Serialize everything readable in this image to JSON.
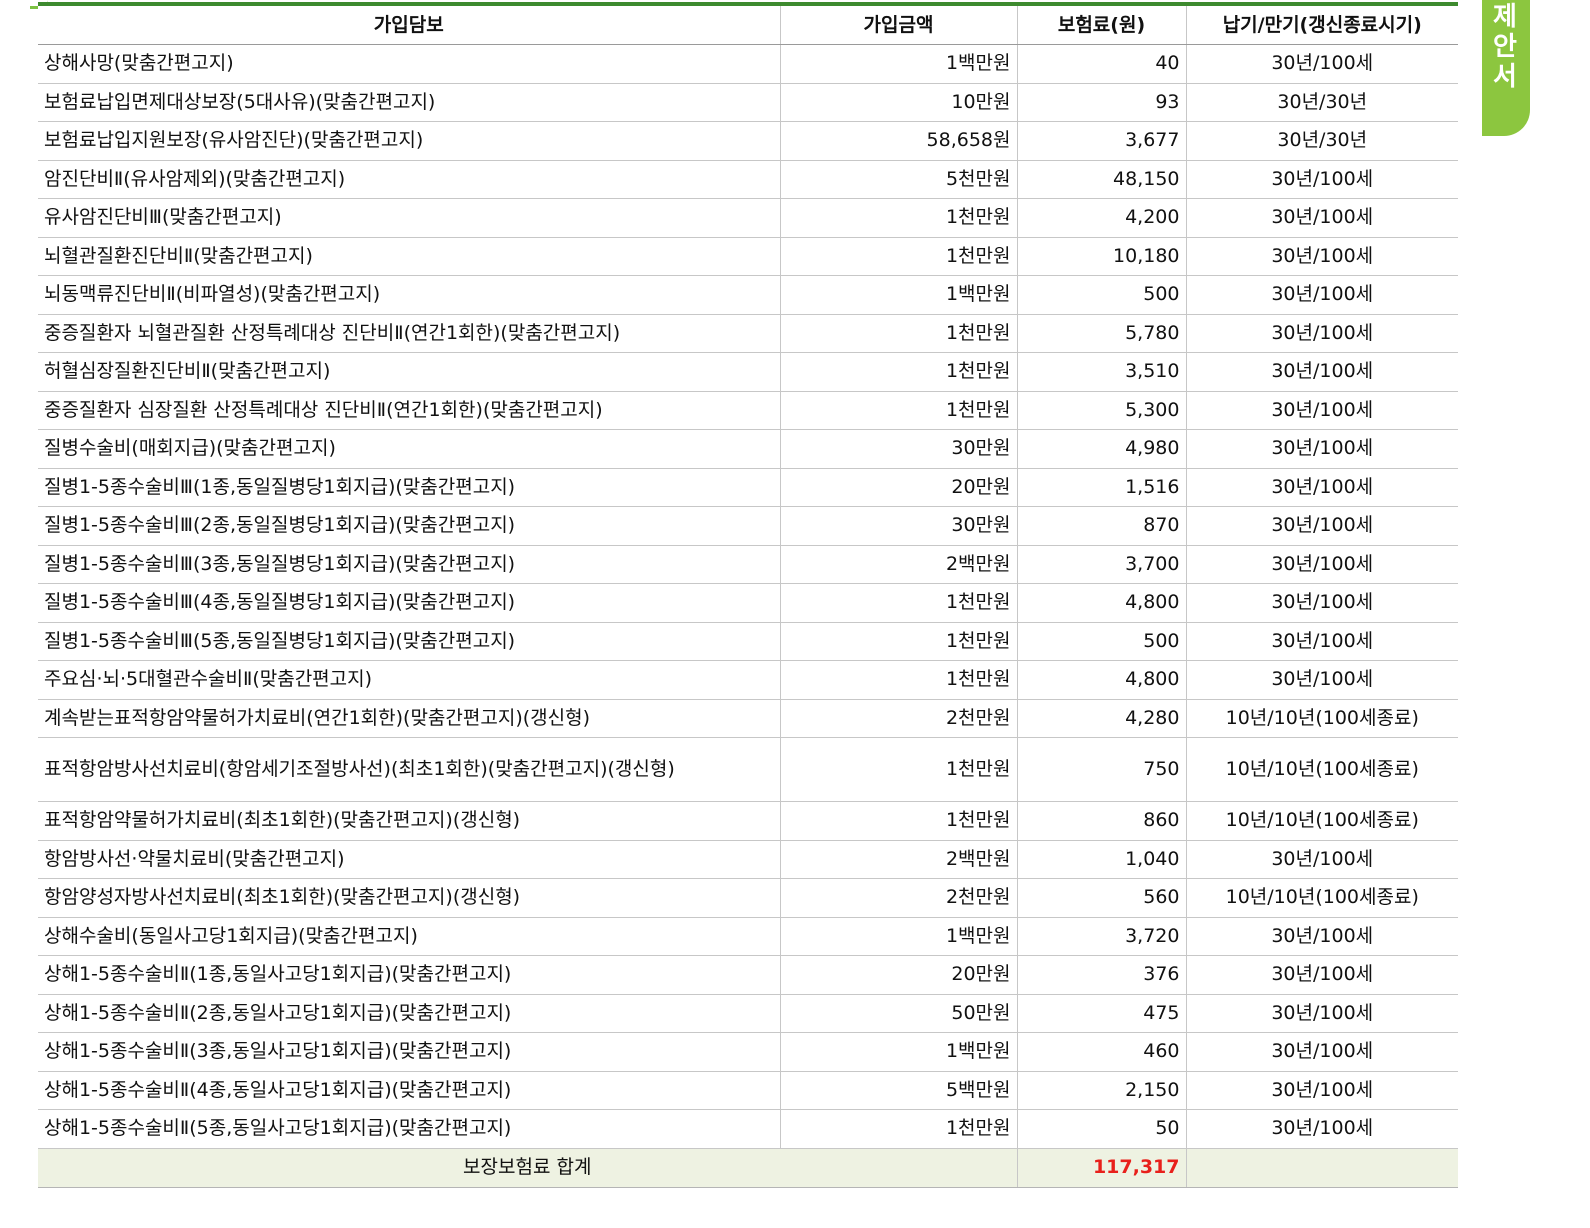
{
  "side_tab": {
    "chars": [
      "제",
      "안",
      "서"
    ]
  },
  "table": {
    "headers": [
      "가입담보",
      "가입금액",
      "보험료(원)",
      "납기/만기(갱신종료시기)"
    ],
    "rows": [
      {
        "name": "상해사망(맞춤간편고지)",
        "amount": "1백만원",
        "premium": "40",
        "period": "30년/100세"
      },
      {
        "name": "보험료납입면제대상보장(5대사유)(맞춤간편고지)",
        "amount": "10만원",
        "premium": "93",
        "period": "30년/30년"
      },
      {
        "name": "보험료납입지원보장(유사암진단)(맞춤간편고지)",
        "amount": "58,658원",
        "premium": "3,677",
        "period": "30년/30년"
      },
      {
        "name": "암진단비Ⅱ(유사암제외)(맞춤간편고지)",
        "amount": "5천만원",
        "premium": "48,150",
        "period": "30년/100세"
      },
      {
        "name": "유사암진단비Ⅲ(맞춤간편고지)",
        "amount": "1천만원",
        "premium": "4,200",
        "period": "30년/100세"
      },
      {
        "name": "뇌혈관질환진단비Ⅱ(맞춤간편고지)",
        "amount": "1천만원",
        "premium": "10,180",
        "period": "30년/100세"
      },
      {
        "name": "뇌동맥류진단비Ⅱ(비파열성)(맞춤간편고지)",
        "amount": "1백만원",
        "premium": "500",
        "period": "30년/100세"
      },
      {
        "name": "중증질환자 뇌혈관질환 산정특례대상 진단비Ⅱ(연간1회한)(맞춤간편고지)",
        "amount": "1천만원",
        "premium": "5,780",
        "period": "30년/100세"
      },
      {
        "name": "허혈심장질환진단비Ⅱ(맞춤간편고지)",
        "amount": "1천만원",
        "premium": "3,510",
        "period": "30년/100세"
      },
      {
        "name": "중증질환자 심장질환 산정특례대상 진단비Ⅱ(연간1회한)(맞춤간편고지)",
        "amount": "1천만원",
        "premium": "5,300",
        "period": "30년/100세"
      },
      {
        "name": "질병수술비(매회지급)(맞춤간편고지)",
        "amount": "30만원",
        "premium": "4,980",
        "period": "30년/100세"
      },
      {
        "name": "질병1-5종수술비Ⅲ(1종,동일질병당1회지급)(맞춤간편고지)",
        "amount": "20만원",
        "premium": "1,516",
        "period": "30년/100세"
      },
      {
        "name": "질병1-5종수술비Ⅲ(2종,동일질병당1회지급)(맞춤간편고지)",
        "amount": "30만원",
        "premium": "870",
        "period": "30년/100세"
      },
      {
        "name": "질병1-5종수술비Ⅲ(3종,동일질병당1회지급)(맞춤간편고지)",
        "amount": "2백만원",
        "premium": "3,700",
        "period": "30년/100세"
      },
      {
        "name": "질병1-5종수술비Ⅲ(4종,동일질병당1회지급)(맞춤간편고지)",
        "amount": "1천만원",
        "premium": "4,800",
        "period": "30년/100세"
      },
      {
        "name": "질병1-5종수술비Ⅲ(5종,동일질병당1회지급)(맞춤간편고지)",
        "amount": "1천만원",
        "premium": "500",
        "period": "30년/100세"
      },
      {
        "name": "주요심·뇌·5대혈관수술비Ⅱ(맞춤간편고지)",
        "amount": "1천만원",
        "premium": "4,800",
        "period": "30년/100세"
      },
      {
        "name": "계속받는표적항암약물허가치료비(연간1회한)(맞춤간편고지)(갱신형)",
        "amount": "2천만원",
        "premium": "4,280",
        "period": "10년/10년(100세종료)"
      },
      {
        "name": "표적항암방사선치료비(항암세기조절방사선)(최초1회한)(맞춤간편고지)(갱신형)",
        "amount": "1천만원",
        "premium": "750",
        "period": "10년/10년(100세종료)",
        "tall": true
      },
      {
        "name": "표적항암약물허가치료비(최초1회한)(맞춤간편고지)(갱신형)",
        "amount": "1천만원",
        "premium": "860",
        "period": "10년/10년(100세종료)"
      },
      {
        "name": "항암방사선·약물치료비(맞춤간편고지)",
        "amount": "2백만원",
        "premium": "1,040",
        "period": "30년/100세"
      },
      {
        "name": "항암양성자방사선치료비(최초1회한)(맞춤간편고지)(갱신형)",
        "amount": "2천만원",
        "premium": "560",
        "period": "10년/10년(100세종료)"
      },
      {
        "name": "상해수술비(동일사고당1회지급)(맞춤간편고지)",
        "amount": "1백만원",
        "premium": "3,720",
        "period": "30년/100세"
      },
      {
        "name": "상해1-5종수술비Ⅱ(1종,동일사고당1회지급)(맞춤간편고지)",
        "amount": "20만원",
        "premium": "376",
        "period": "30년/100세"
      },
      {
        "name": "상해1-5종수술비Ⅱ(2종,동일사고당1회지급)(맞춤간편고지)",
        "amount": "50만원",
        "premium": "475",
        "period": "30년/100세"
      },
      {
        "name": "상해1-5종수술비Ⅱ(3종,동일사고당1회지급)(맞춤간편고지)",
        "amount": "1백만원",
        "premium": "460",
        "period": "30년/100세"
      },
      {
        "name": "상해1-5종수술비Ⅱ(4종,동일사고당1회지급)(맞춤간편고지)",
        "amount": "5백만원",
        "premium": "2,150",
        "period": "30년/100세"
      },
      {
        "name": "상해1-5종수술비Ⅱ(5종,동일사고당1회지급)(맞춤간편고지)",
        "amount": "1천만원",
        "premium": "50",
        "period": "30년/100세"
      }
    ],
    "total": {
      "label": "보장보험료 합계",
      "value": "117,317",
      "value_color": "#e8201b"
    }
  }
}
